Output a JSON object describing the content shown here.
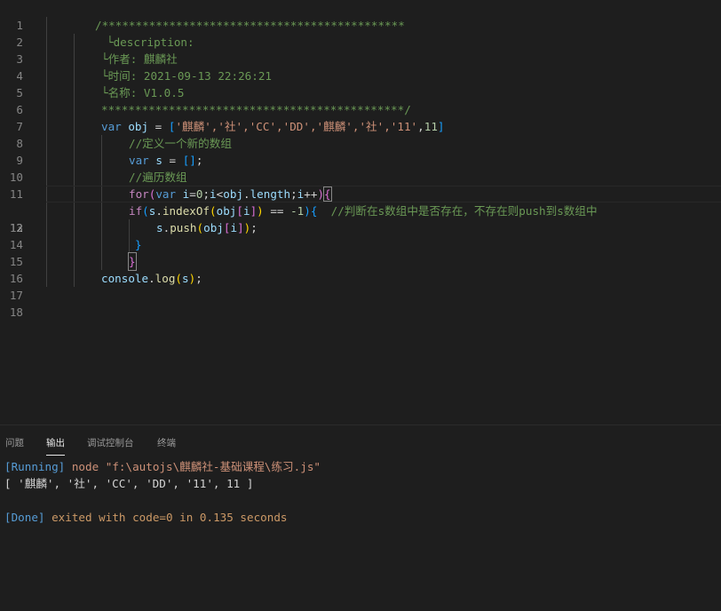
{
  "editor": {
    "active_line": 12,
    "line_numbers": [
      "1",
      "2",
      "3",
      "4",
      "5",
      "6",
      "7",
      "8",
      "9",
      "10",
      "11",
      "12",
      "13",
      "14",
      "15",
      "16",
      "17",
      "18"
    ],
    "l2": "/*********************************************",
    "l3": "└description:",
    "l4": "└作者: 麒麟社",
    "l5": "└时间: 2021-09-13 22:26:21",
    "l6": "└名称: V1.0.5",
    "l7": "*********************************************/",
    "l8": {
      "kw": "var",
      "name": "obj",
      "eq": " = ",
      "open": "[",
      "items": "'麒麟','社','CC','DD','麒麟','社','11'",
      "sep": ",",
      "num": "11",
      "close": "]"
    },
    "l9": "//定义一个新的数组",
    "l10": {
      "kw": "var",
      "name": "s",
      "rest": " = ",
      "arr": "[]",
      "semi": ";"
    },
    "l11": "//遍历数组",
    "l12": {
      "for": "for",
      "p1": "(",
      "var": "var",
      "i": " i",
      "eq": "=",
      "zero": "0",
      "semi1": ";",
      "i2": "i",
      "lt": "<",
      "obj": "obj",
      "dot": ".",
      "length": "length",
      "semi2": ";",
      "i3": "i",
      "inc": "++",
      "p2": ")",
      "brace": "{"
    },
    "l13": {
      "if": "if",
      "p1": "(",
      "s": "s",
      "dot": ".",
      "fn": "indexOf",
      "p2": "(",
      "obj": "obj",
      "b1": "[",
      "i": "i",
      "b2": "]",
      "p3": ")",
      "op": " == ",
      "neg": "-1",
      "p4": ")",
      "brace": "{",
      "comment": "//判断在s数组中是否存在，不存在则push到s数组中"
    },
    "l14": {
      "s": "s",
      "dot": ".",
      "fn": "push",
      "p1": "(",
      "obj": "obj",
      "b1": "[",
      "i": "i",
      "b2": "]",
      "p2": ")",
      "semi": ";"
    },
    "l15": "}",
    "l16": "}",
    "l17": {
      "obj": "console",
      "dot": ".",
      "fn": "log",
      "p1": "(",
      "s": "s",
      "p2": ")",
      "semi": ";"
    }
  },
  "panel": {
    "tabs": [
      "问题",
      "输出",
      "调试控制台",
      "终端"
    ],
    "active_tab": "输出",
    "running_tag": "[Running]",
    "running_cmd": " node \"f:\\autojs\\麒麟社-基础课程\\练习.js\"",
    "result": "[ '麒麟', '社', 'CC', 'DD', '11', 11 ]",
    "done_tag": "[Done]",
    "done_text1": " exited with ",
    "done_code": "code=0",
    "done_text2": " in ",
    "done_time": "0.135 seconds"
  },
  "colors": {
    "background": "#1e1e1e",
    "comment": "#6a9955",
    "keyword": "#569cd6",
    "string": "#ce9178",
    "variable": "#9cdcfe",
    "function": "#dcdcaa"
  }
}
